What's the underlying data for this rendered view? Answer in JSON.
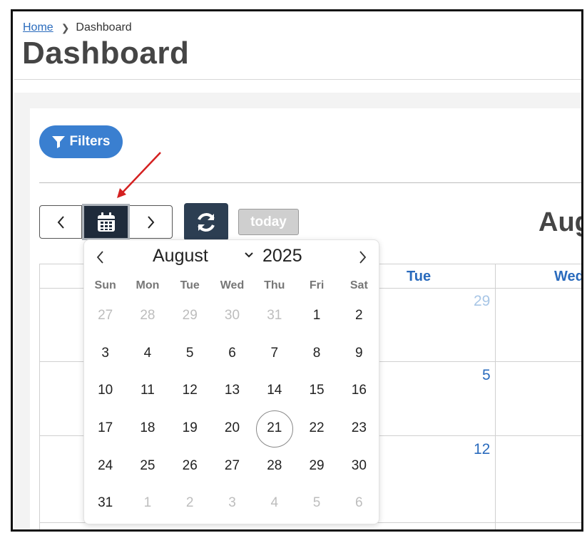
{
  "breadcrumb": {
    "home": "Home",
    "current": "Dashboard"
  },
  "page": {
    "title": "Dashboard"
  },
  "toolbar": {
    "filters_label": "Filters",
    "today_label": "today",
    "month_title": "Aug"
  },
  "calendar_grid": {
    "column_headers": [
      "Tue",
      "Wed"
    ],
    "day_numbers": [
      "29",
      "5",
      "12"
    ]
  },
  "datepicker": {
    "month": "August",
    "year": "2025",
    "weekdays": [
      "Sun",
      "Mon",
      "Tue",
      "Wed",
      "Thu",
      "Fri",
      "Sat"
    ],
    "weeks": [
      [
        "27",
        "28",
        "29",
        "30",
        "31",
        "1",
        "2"
      ],
      [
        "3",
        "4",
        "5",
        "6",
        "7",
        "8",
        "9"
      ],
      [
        "10",
        "11",
        "12",
        "13",
        "14",
        "15",
        "16"
      ],
      [
        "17",
        "18",
        "19",
        "20",
        "21",
        "22",
        "23"
      ],
      [
        "24",
        "25",
        "26",
        "27",
        "28",
        "29",
        "30"
      ],
      [
        "31",
        "1",
        "2",
        "3",
        "4",
        "5",
        "6"
      ]
    ],
    "selected_day": "21"
  },
  "colors": {
    "accent": "#3a7fd0",
    "dark_button": "#2c3e52",
    "annotation_arrow": "#d42020"
  }
}
